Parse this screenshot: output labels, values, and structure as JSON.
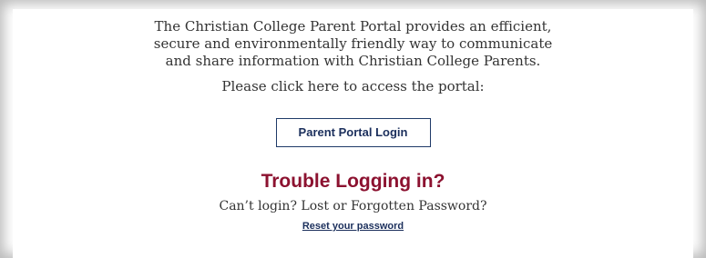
{
  "portal": {
    "intro_text": "The Christian College Parent Portal provides an efficient, secure and environmentally friendly way to communicate and share information with Christian College Parents.",
    "prompt_text": "Please click here to access the portal:",
    "login_button_label": "Parent Portal Login"
  },
  "trouble": {
    "heading": "Trouble Logging in?",
    "subtext": "Can’t login? Lost or Forgotten Password?",
    "reset_link": "Reset your password"
  },
  "colors": {
    "heading": "#8c1230",
    "link": "#1b2f5c",
    "button_border": "#1f3a68",
    "text": "#333333"
  }
}
